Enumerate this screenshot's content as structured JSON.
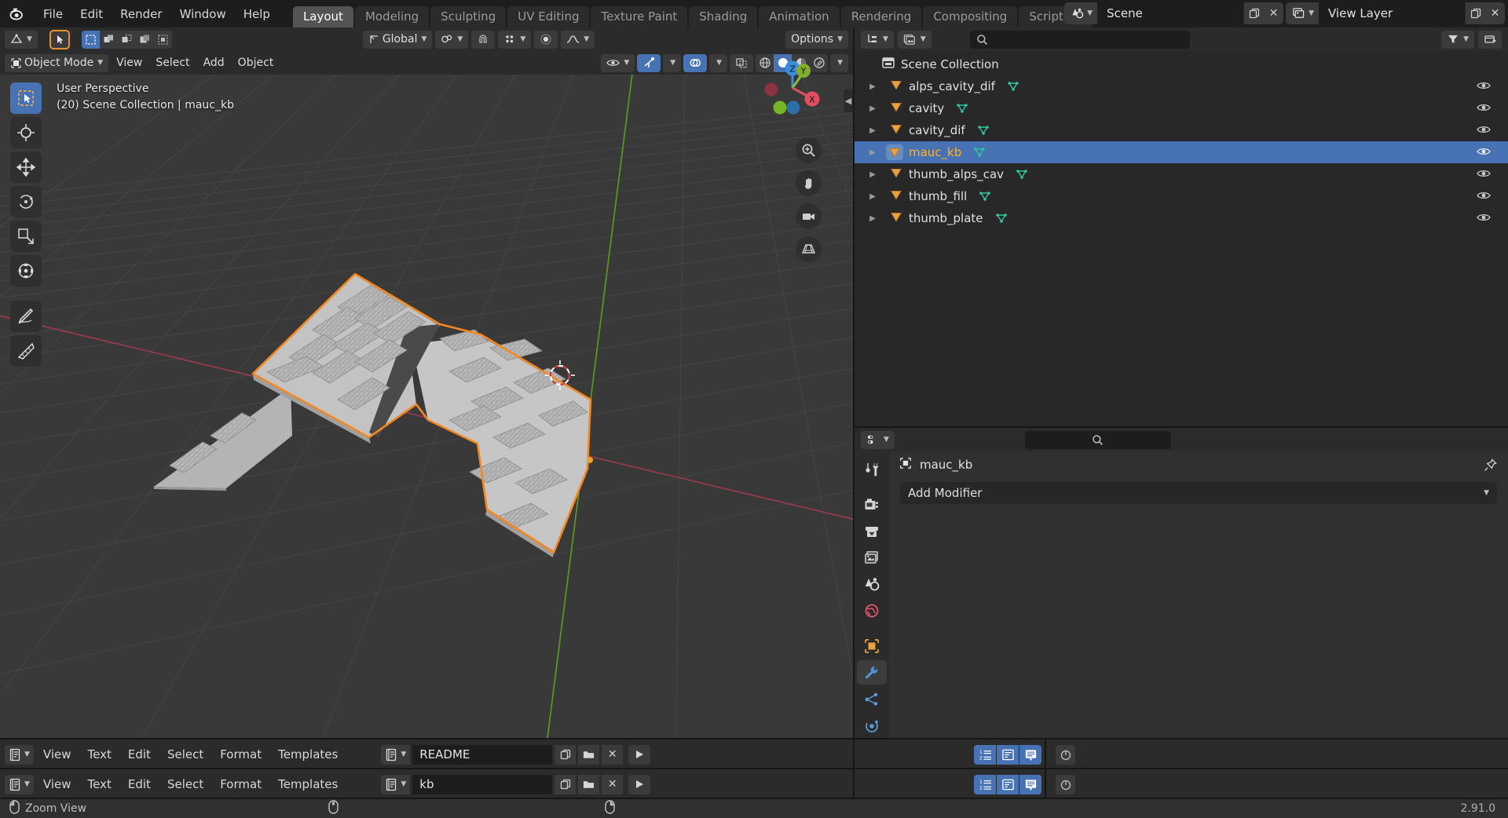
{
  "app": {
    "name": "Blender",
    "version": "2.91.0"
  },
  "topbar": {
    "menus": [
      "File",
      "Edit",
      "Render",
      "Window",
      "Help"
    ],
    "workspaces": [
      {
        "label": "Layout",
        "active": true
      },
      {
        "label": "Modeling",
        "active": false
      },
      {
        "label": "Sculpting",
        "active": false
      },
      {
        "label": "UV Editing",
        "active": false
      },
      {
        "label": "Texture Paint",
        "active": false
      },
      {
        "label": "Shading",
        "active": false
      },
      {
        "label": "Animation",
        "active": false
      },
      {
        "label": "Rendering",
        "active": false
      },
      {
        "label": "Compositing",
        "active": false
      },
      {
        "label": "Scripting",
        "active": false
      }
    ],
    "scene": {
      "icon": "scene-icon",
      "name": "Scene",
      "new_label": "",
      "unlink_label": "✕"
    },
    "view_layer": {
      "icon": "view-layer-icon",
      "name": "View Layer",
      "new_label": "",
      "remove_label": "✕"
    }
  },
  "viewport": {
    "header": {
      "editor_type_icon": "editor-type-3dview-icon",
      "cursor_tool_icon": "select-box-icon",
      "select_modes": [
        "set",
        "extend",
        "subtract",
        "invert",
        "intersect"
      ],
      "transform_orientation": "Global",
      "snap_icon": "magnet-icon",
      "snap_target_icon": "snap-target-icon",
      "proportional_icon": "proportional-edit-icon",
      "falloff_icon": "falloff-curve-icon",
      "options_label": "Options"
    },
    "header2": {
      "mode": "Object Mode",
      "menus": [
        "View",
        "Select",
        "Add",
        "Object"
      ],
      "visibility_icon": "eye-icon",
      "gizmo_icon": "gizmo-icon",
      "overlays_icon": "overlays-icon",
      "xray_icon": "xray-icon",
      "shading_modes": [
        "wireframe",
        "solid",
        "material-preview",
        "rendered"
      ],
      "active_shading": "solid"
    },
    "overlay": {
      "perspective": "User Perspective",
      "collection_info": "(20) Scene Collection | mauc_kb"
    },
    "tools": [
      {
        "name": "tweak-tool",
        "active": true
      },
      {
        "name": "cursor-tool",
        "active": false
      },
      {
        "name": "move-tool",
        "active": false
      },
      {
        "name": "rotate-tool",
        "active": false
      },
      {
        "name": "scale-tool",
        "active": false
      },
      {
        "name": "transform-tool",
        "active": false
      },
      {
        "name": "annotate-tool",
        "active": false
      },
      {
        "name": "measure-tool",
        "active": false
      }
    ],
    "nav_gizmo": {
      "axes": [
        "X",
        "Y",
        "Z"
      ],
      "x_color": "#e04f5f",
      "y_color": "#8fc132",
      "z_color": "#3c8ce0"
    },
    "nav_buttons": [
      "zoom-icon",
      "pan-hand-icon",
      "camera-view-icon",
      "toggle-perspective-icon"
    ]
  },
  "outliner": {
    "display_mode_icon": "outliner-display-mode-icon",
    "filter_id_icon": "filter-id-icon",
    "search_placeholder": "",
    "filter_icon": "filter-funnel-icon",
    "new_collection_icon": "new-collection-icon",
    "root": {
      "label": "Scene Collection",
      "icon": "collection-icon"
    },
    "items": [
      {
        "label": "alps_cavity_dif",
        "icon": "mesh-object-icon",
        "selected": false,
        "has_mesh_data": true,
        "visible": true
      },
      {
        "label": "cavity",
        "icon": "mesh-object-icon",
        "selected": false,
        "has_mesh_data": true,
        "visible": true
      },
      {
        "label": "cavity_dif",
        "icon": "mesh-object-icon",
        "selected": false,
        "has_mesh_data": true,
        "visible": true
      },
      {
        "label": "mauc_kb",
        "icon": "mesh-object-icon",
        "selected": true,
        "has_mesh_data": true,
        "visible": true
      },
      {
        "label": "thumb_alps_cav",
        "icon": "mesh-object-icon",
        "selected": false,
        "has_mesh_data": true,
        "visible": true
      },
      {
        "label": "thumb_fill",
        "icon": "mesh-object-icon",
        "selected": false,
        "has_mesh_data": true,
        "visible": true
      },
      {
        "label": "thumb_plate",
        "icon": "mesh-object-icon",
        "selected": false,
        "has_mesh_data": true,
        "visible": true
      }
    ]
  },
  "properties": {
    "editor_icon": "properties-editor-icon",
    "search_placeholder": "",
    "breadcrumb": {
      "object_icon": "object-icon",
      "object_name": "mauc_kb"
    },
    "pin_icon": "pin-icon",
    "tabs": [
      {
        "name": "tool-tab",
        "icon": "tool-icon",
        "active": false,
        "color": "#d4d4d4"
      },
      {
        "name": "render-tab",
        "icon": "camera-back-icon",
        "active": false,
        "color": "#d4d4d4"
      },
      {
        "name": "output-tab",
        "icon": "printer-icon",
        "active": false,
        "color": "#d4d4d4"
      },
      {
        "name": "view-layer-tab",
        "icon": "images-icon",
        "active": false,
        "color": "#d4d4d4"
      },
      {
        "name": "scene-tab",
        "icon": "scene-cone-icon",
        "active": false,
        "color": "#d4d4d4"
      },
      {
        "name": "world-tab",
        "icon": "world-globe-icon",
        "active": false,
        "color": "#e0566a"
      },
      {
        "name": "object-tab",
        "icon": "object-square-icon",
        "active": false,
        "color": "#e8a33d"
      },
      {
        "name": "modifier-tab",
        "icon": "wrench-icon",
        "active": true,
        "color": "#4f90d8"
      },
      {
        "name": "particles-tab",
        "icon": "particles-icon",
        "active": false,
        "color": "#5b9bd8"
      },
      {
        "name": "physics-tab",
        "icon": "physics-orbit-icon",
        "active": false,
        "color": "#5b9bd8"
      }
    ],
    "add_modifier_label": "Add Modifier"
  },
  "text_editors": [
    {
      "editor_type_icon": "editor-type-text-icon",
      "menus": [
        "View",
        "Text",
        "Edit",
        "Select",
        "Format",
        "Templates"
      ],
      "datablock_icon": "text-datablock-icon",
      "name": "README",
      "new_icon": "duplicate-icon",
      "open_icon": "folder-open-icon",
      "unlink_icon": "✕",
      "run_icon": "play-icon",
      "toggles": [
        {
          "name": "line-numbers-toggle",
          "icon": "line-numbers-icon",
          "on": true
        },
        {
          "name": "word-wrap-toggle",
          "icon": "word-wrap-icon",
          "on": true
        },
        {
          "name": "syntax-highlight-toggle",
          "icon": "syntax-highlight-icon",
          "on": true
        }
      ],
      "right_icon": "text-run-icon"
    },
    {
      "editor_type_icon": "editor-type-text-icon",
      "menus": [
        "View",
        "Text",
        "Edit",
        "Select",
        "Format",
        "Templates"
      ],
      "datablock_icon": "text-datablock-icon",
      "name": "kb",
      "new_icon": "duplicate-icon",
      "open_icon": "folder-open-icon",
      "unlink_icon": "✕",
      "run_icon": "play-icon",
      "toggles": [
        {
          "name": "line-numbers-toggle",
          "icon": "line-numbers-icon",
          "on": true
        },
        {
          "name": "word-wrap-toggle",
          "icon": "word-wrap-icon",
          "on": true
        },
        {
          "name": "syntax-highlight-toggle",
          "icon": "syntax-highlight-icon",
          "on": true
        }
      ],
      "right_icon": "text-run-icon"
    }
  ],
  "statusbar": {
    "items": [
      {
        "icon": "mouse-left-icon",
        "label": "Zoom View"
      },
      {
        "icon": "mouse-middle-icon",
        "label": ""
      },
      {
        "icon": "mouse-right-icon",
        "label": ""
      }
    ],
    "version": "2.91.0"
  },
  "colors": {
    "accent_blue": "#4772b3",
    "selected_text_orange": "#ffaf29",
    "object_outline_orange": "#f5871f",
    "mesh_data_green": "#31c4a0",
    "object_icon_orange": "#e8a33d",
    "viewport_bg": "#393939",
    "panel_bg": "#2b2b2b",
    "editor_bg": "#282828"
  }
}
